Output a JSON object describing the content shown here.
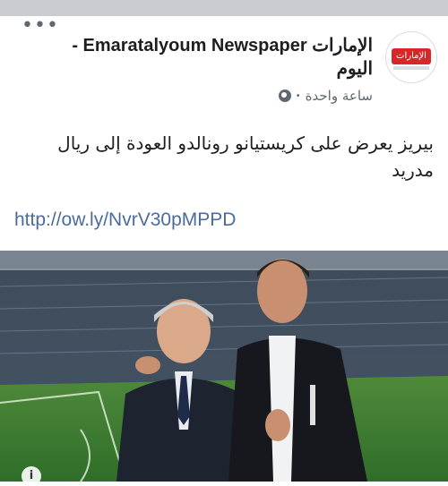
{
  "post": {
    "page_name": "- Emaratalyoum Newspaper الإمارات اليوم",
    "logo_text": "الإمارات اليوم",
    "timestamp": "ساعة واحدة",
    "meta_separator": "•",
    "text": "بيريز يعرض على كريستيانو رونالدو العودة إلى ريال مدريد",
    "link": "http://ow.ly/NvrV30pMPPD",
    "more_label": "•••",
    "info_label": "i"
  },
  "colors": {
    "topbar": "#c9ccd1",
    "link": "#4b6c9b",
    "logo_red": "#d62828",
    "meta": "#606770"
  },
  "icons": [
    "more-options-icon",
    "globe-icon",
    "info-icon"
  ]
}
